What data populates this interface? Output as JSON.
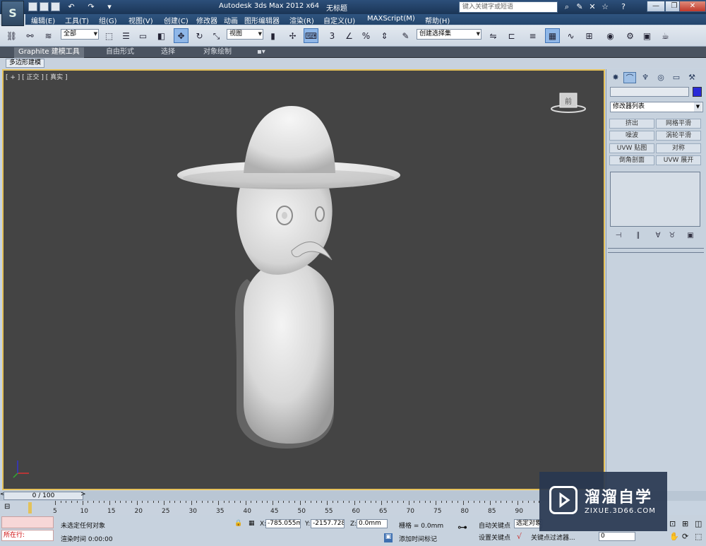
{
  "window": {
    "title": "Autodesk 3ds Max  2012 x64",
    "document": "无标题",
    "search_placeholder": "键入关键字或短语",
    "logo_text": "S"
  },
  "menu": [
    "编辑(E)",
    "工具(T)",
    "组(G)",
    "视图(V)",
    "创建(C)",
    "修改器",
    "动画",
    "图形编辑器",
    "渲染(R)",
    "自定义(U)",
    "MAXScript(M)",
    "帮助(H)"
  ],
  "toolbar": {
    "selection_filter": "全部",
    "reference_coord": "视图",
    "named_selection": "创建选择集",
    "snap_label": "3",
    "angle_snap": "%"
  },
  "ribbon": {
    "tabs": [
      "Graphite 建模工具",
      "自由形式",
      "选择",
      "对象绘制"
    ],
    "active_tab": "Graphite 建模工具",
    "panel_label": "多边形建模"
  },
  "viewport": {
    "label": "[ + ] [ 正交 ] [ 真实 ]",
    "viewcube_label": "前",
    "border_color": "#e6c25a",
    "background": "#444444"
  },
  "command_panel": {
    "modifier_list": "修改器列表",
    "modifier_buttons": [
      "挤出",
      "网格平滑",
      "噪波",
      "涡轮平滑",
      "UVW 贴图",
      "对称",
      "倒角剖面",
      "UVW 展开"
    ],
    "swatch_color": "#2a2ad8"
  },
  "timeline": {
    "frame": "0 / 100",
    "ticks": [
      "5",
      "10",
      "15",
      "20",
      "25",
      "30",
      "35",
      "40",
      "45",
      "50",
      "55",
      "60",
      "65",
      "70",
      "75",
      "80",
      "85",
      "90"
    ]
  },
  "status": {
    "maxscript": "所在行:",
    "selection": "未选定任何对象",
    "render_time": "渲染时间 0:00:00",
    "x_label": "X:",
    "x_value": "-785.055m",
    "y_label": "Y:",
    "y_value": "-2157.728",
    "z_label": "Z:",
    "z_value": "0.0mm",
    "grid": "栅格 = 0.0mm",
    "add_time_tag": "添加时间标记",
    "auto_key": "自动关键点",
    "set_key": "设置关键点",
    "selected": "选定对象",
    "key_filters": "关键点过滤器...",
    "current_frame": "0"
  },
  "watermark": {
    "title": "溜溜自学",
    "url": "ZIXUE.3D66.COM"
  }
}
